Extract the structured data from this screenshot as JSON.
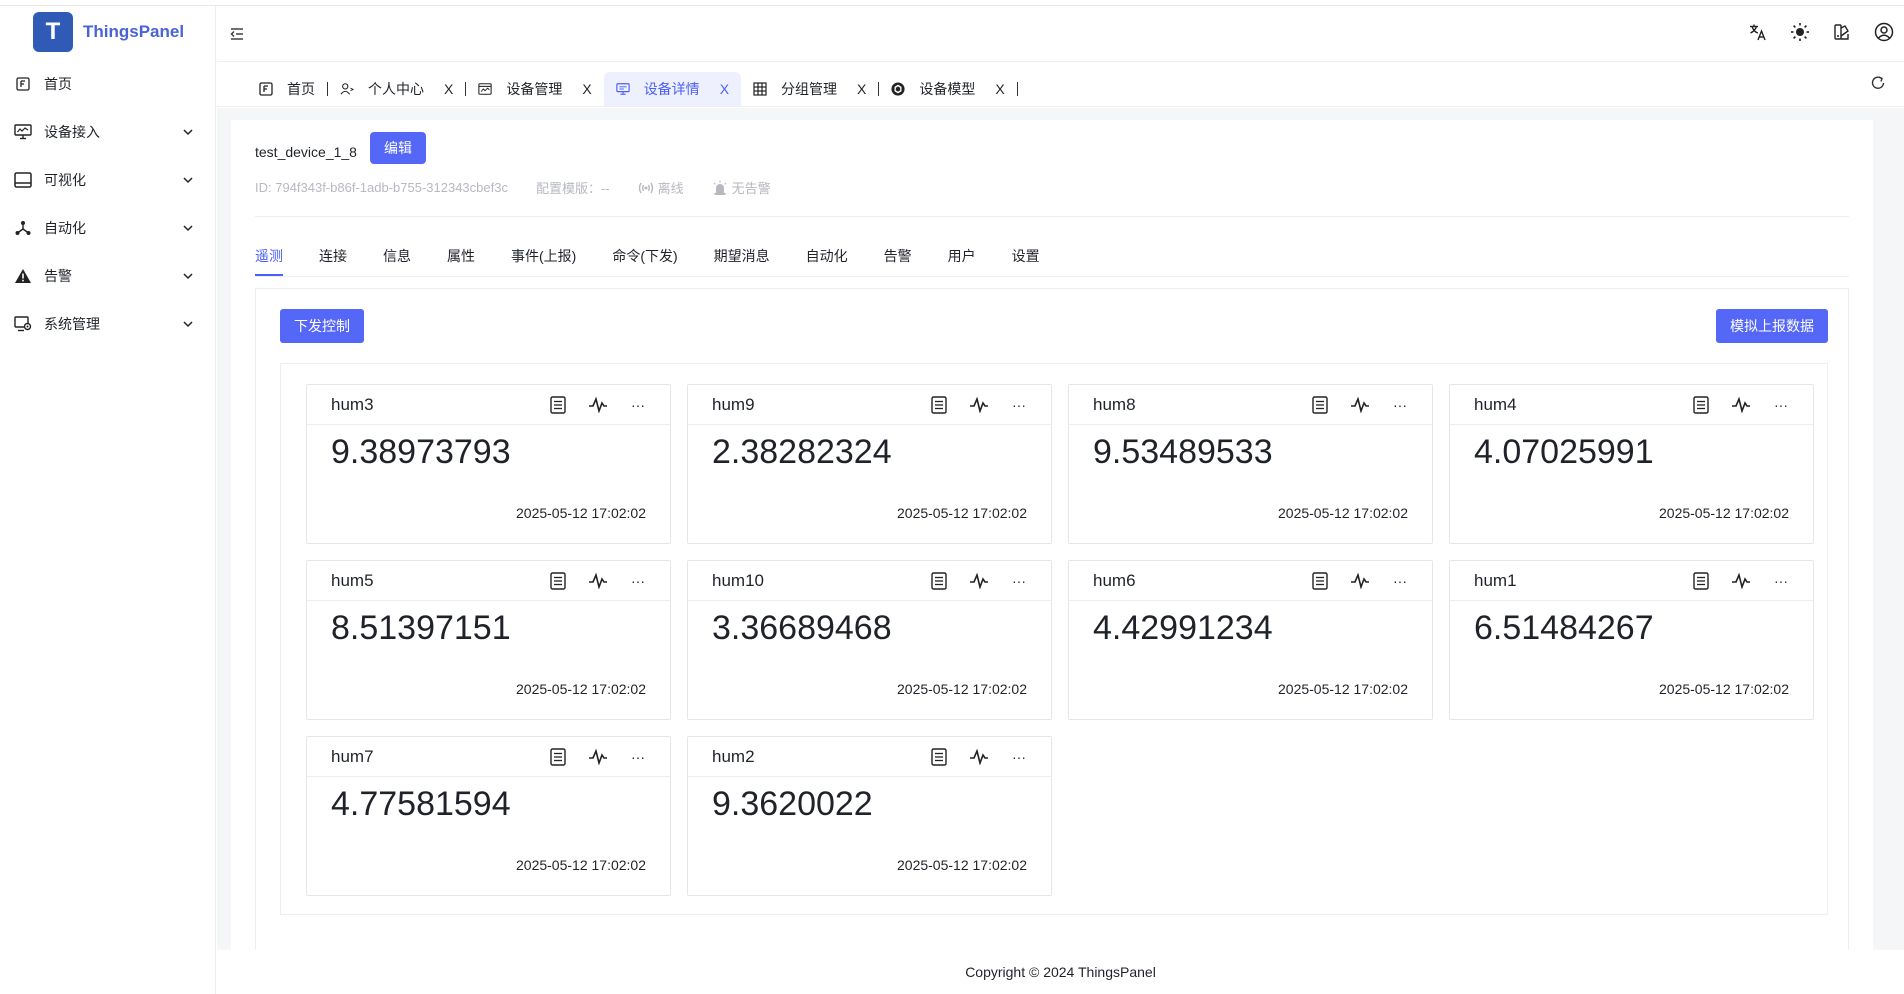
{
  "app": {
    "logo_text": "ThingsPanel",
    "logo_mark": "T"
  },
  "sidebar": {
    "items": [
      {
        "label": "首页",
        "icon": "home-icon",
        "has_children": false
      },
      {
        "label": "设备接入",
        "icon": "monitor-icon",
        "has_children": true
      },
      {
        "label": "可视化",
        "icon": "dashboard-icon",
        "has_children": true
      },
      {
        "label": "自动化",
        "icon": "automation-icon",
        "has_children": true
      },
      {
        "label": "告警",
        "icon": "warning-icon",
        "has_children": true
      },
      {
        "label": "系统管理",
        "icon": "system-icon",
        "has_children": true
      }
    ]
  },
  "tabs": [
    {
      "label": "首页",
      "closable": false,
      "active": false
    },
    {
      "label": "个人中心",
      "closable": true,
      "active": false
    },
    {
      "label": "设备管理",
      "closable": true,
      "active": false
    },
    {
      "label": "设备详情",
      "closable": true,
      "active": true
    },
    {
      "label": "分组管理",
      "closable": true,
      "active": false
    },
    {
      "label": "设备模型",
      "closable": true,
      "active": false
    }
  ],
  "tab_close_glyph": "X",
  "device": {
    "name": "test_device_1_8",
    "edit_label": "编辑",
    "id_text": "ID:  794f343f-b86f-1adb-b755-312343cbef3c",
    "template_text": "配置模版：--",
    "status_text": "离线",
    "alarm_text": "无告警"
  },
  "subtabs": [
    "遥测",
    "连接",
    "信息",
    "属性",
    "事件(上报)",
    "命令(下发)",
    "期望消息",
    "自动化",
    "告警",
    "用户",
    "设置"
  ],
  "telemetry": {
    "control_label": "下发控制",
    "simulate_label": "模拟上报数据",
    "more_glyph": "···",
    "cards": [
      {
        "name": "hum3",
        "value": "9.38973793",
        "time": "2025-05-12 17:02:02"
      },
      {
        "name": "hum9",
        "value": "2.38282324",
        "time": "2025-05-12 17:02:02"
      },
      {
        "name": "hum8",
        "value": "9.53489533",
        "time": "2025-05-12 17:02:02"
      },
      {
        "name": "hum4",
        "value": "4.07025991",
        "time": "2025-05-12 17:02:02"
      },
      {
        "name": "hum5",
        "value": "8.51397151",
        "time": "2025-05-12 17:02:02"
      },
      {
        "name": "hum10",
        "value": "3.36689468",
        "time": "2025-05-12 17:02:02"
      },
      {
        "name": "hum6",
        "value": "4.42991234",
        "time": "2025-05-12 17:02:02"
      },
      {
        "name": "hum1",
        "value": "6.51484267",
        "time": "2025-05-12 17:02:02"
      },
      {
        "name": "hum7",
        "value": "4.77581594",
        "time": "2025-05-12 17:02:02"
      },
      {
        "name": "hum2",
        "value": "9.3620022",
        "time": "2025-05-12 17:02:02"
      }
    ]
  },
  "footer": {
    "copyright": "Copyright © 2024 ThingsPanel"
  },
  "colors": {
    "accent": "#5567f7",
    "active_tab_bg": "#eef1fd",
    "muted_text": "#b6b9bf"
  }
}
